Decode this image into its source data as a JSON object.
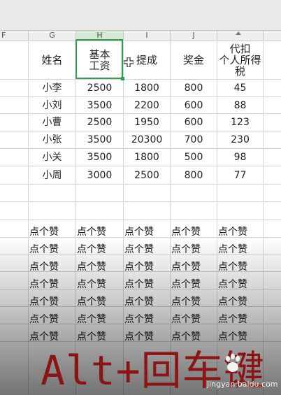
{
  "columns": [
    "F",
    "G",
    "H",
    "I",
    "J",
    ""
  ],
  "headers": [
    "姓名",
    "基本\n工资",
    "提成",
    "奖金",
    "代扣\n个人所得\n税"
  ],
  "rows": [
    [
      "小李",
      "2500",
      "1800",
      "800",
      "45"
    ],
    [
      "小刘",
      "3500",
      "2200",
      "600",
      "88"
    ],
    [
      "小曹",
      "2500",
      "1950",
      "600",
      "123"
    ],
    [
      "小张",
      "3500",
      "20300",
      "700",
      "230"
    ],
    [
      "小关",
      "3500",
      "1800",
      "500",
      "98"
    ],
    [
      "小周",
      "3000",
      "2500",
      "800",
      "77"
    ]
  ],
  "fill_text": "点个赞",
  "caption": "Alt+回车键",
  "watermark": "jingyan.baidu.com",
  "colors": {
    "selection": "#2f9e4a",
    "caption": "#8b1414"
  },
  "icons": {
    "cursor": "cell-cross-cursor-icon",
    "sort": "sort-arrow-icon",
    "logo": "baidu-paw-icon"
  }
}
